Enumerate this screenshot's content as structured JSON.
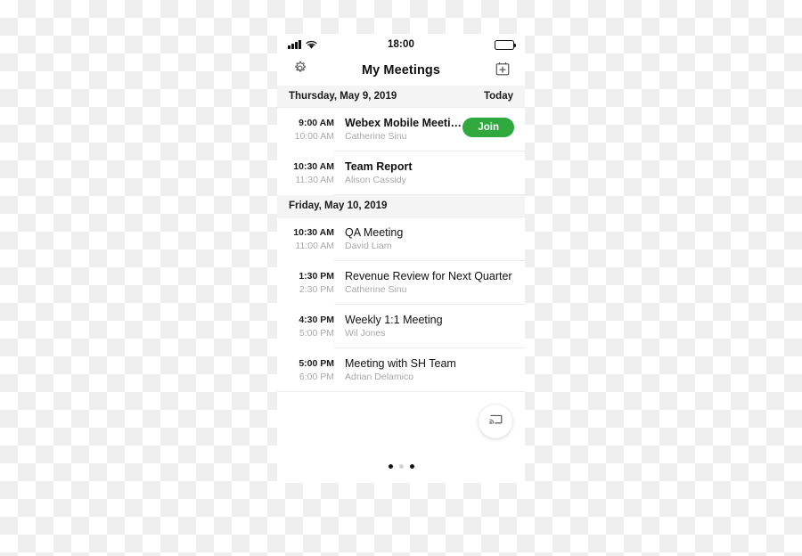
{
  "colors": {
    "join_green": "#2fa93e",
    "day_header_bg": "#f4f4f4",
    "muted_text": "#a8a8a8",
    "divider": "#ececec"
  },
  "status_bar": {
    "time": "18:00",
    "signal_icon": "cellular-signal-icon",
    "wifi_icon": "wifi-icon",
    "battery_icon": "battery-icon"
  },
  "nav": {
    "title": "My Meetings",
    "settings_icon": "gear-icon",
    "add_icon": "calendar-plus-icon"
  },
  "days": [
    {
      "date_label": "Thursday, May 9, 2019",
      "today_label": "Today",
      "meetings": [
        {
          "start": "9:00 AM",
          "end": "10:00 AM",
          "title": "Webex Mobile Meeting",
          "host": "Catherine Sinu",
          "bold": true,
          "join_label": "Join"
        },
        {
          "start": "10:30 AM",
          "end": "11:30 AM",
          "title": "Team Report",
          "host": "Alison Cassidy",
          "bold": true,
          "join_label": null
        }
      ]
    },
    {
      "date_label": "Friday, May 10, 2019",
      "today_label": "",
      "meetings": [
        {
          "start": "10:30 AM",
          "end": "11:00 AM",
          "title": "QA Meeting",
          "host": "David Liam",
          "bold": false,
          "join_label": null
        },
        {
          "start": "1:30 PM",
          "end": "2:30 PM",
          "title": "Revenue Review for Next Quarter",
          "host": "Catherine Sinu",
          "bold": false,
          "join_label": null
        },
        {
          "start": "4:30 PM",
          "end": "5:00 PM",
          "title": "Weekly 1:1 Meeting",
          "host": "Wil Jones",
          "bold": false,
          "join_label": null
        },
        {
          "start": "5:00 PM",
          "end": "6:00 PM",
          "title": "Meeting with SH Team",
          "host": "Adrian Delamico",
          "bold": false,
          "join_label": null
        }
      ]
    }
  ],
  "fab": {
    "icon": "screen-cast-icon"
  },
  "pager": {
    "total": 3,
    "active_index": 0,
    "dim_indices": [
      1
    ]
  }
}
